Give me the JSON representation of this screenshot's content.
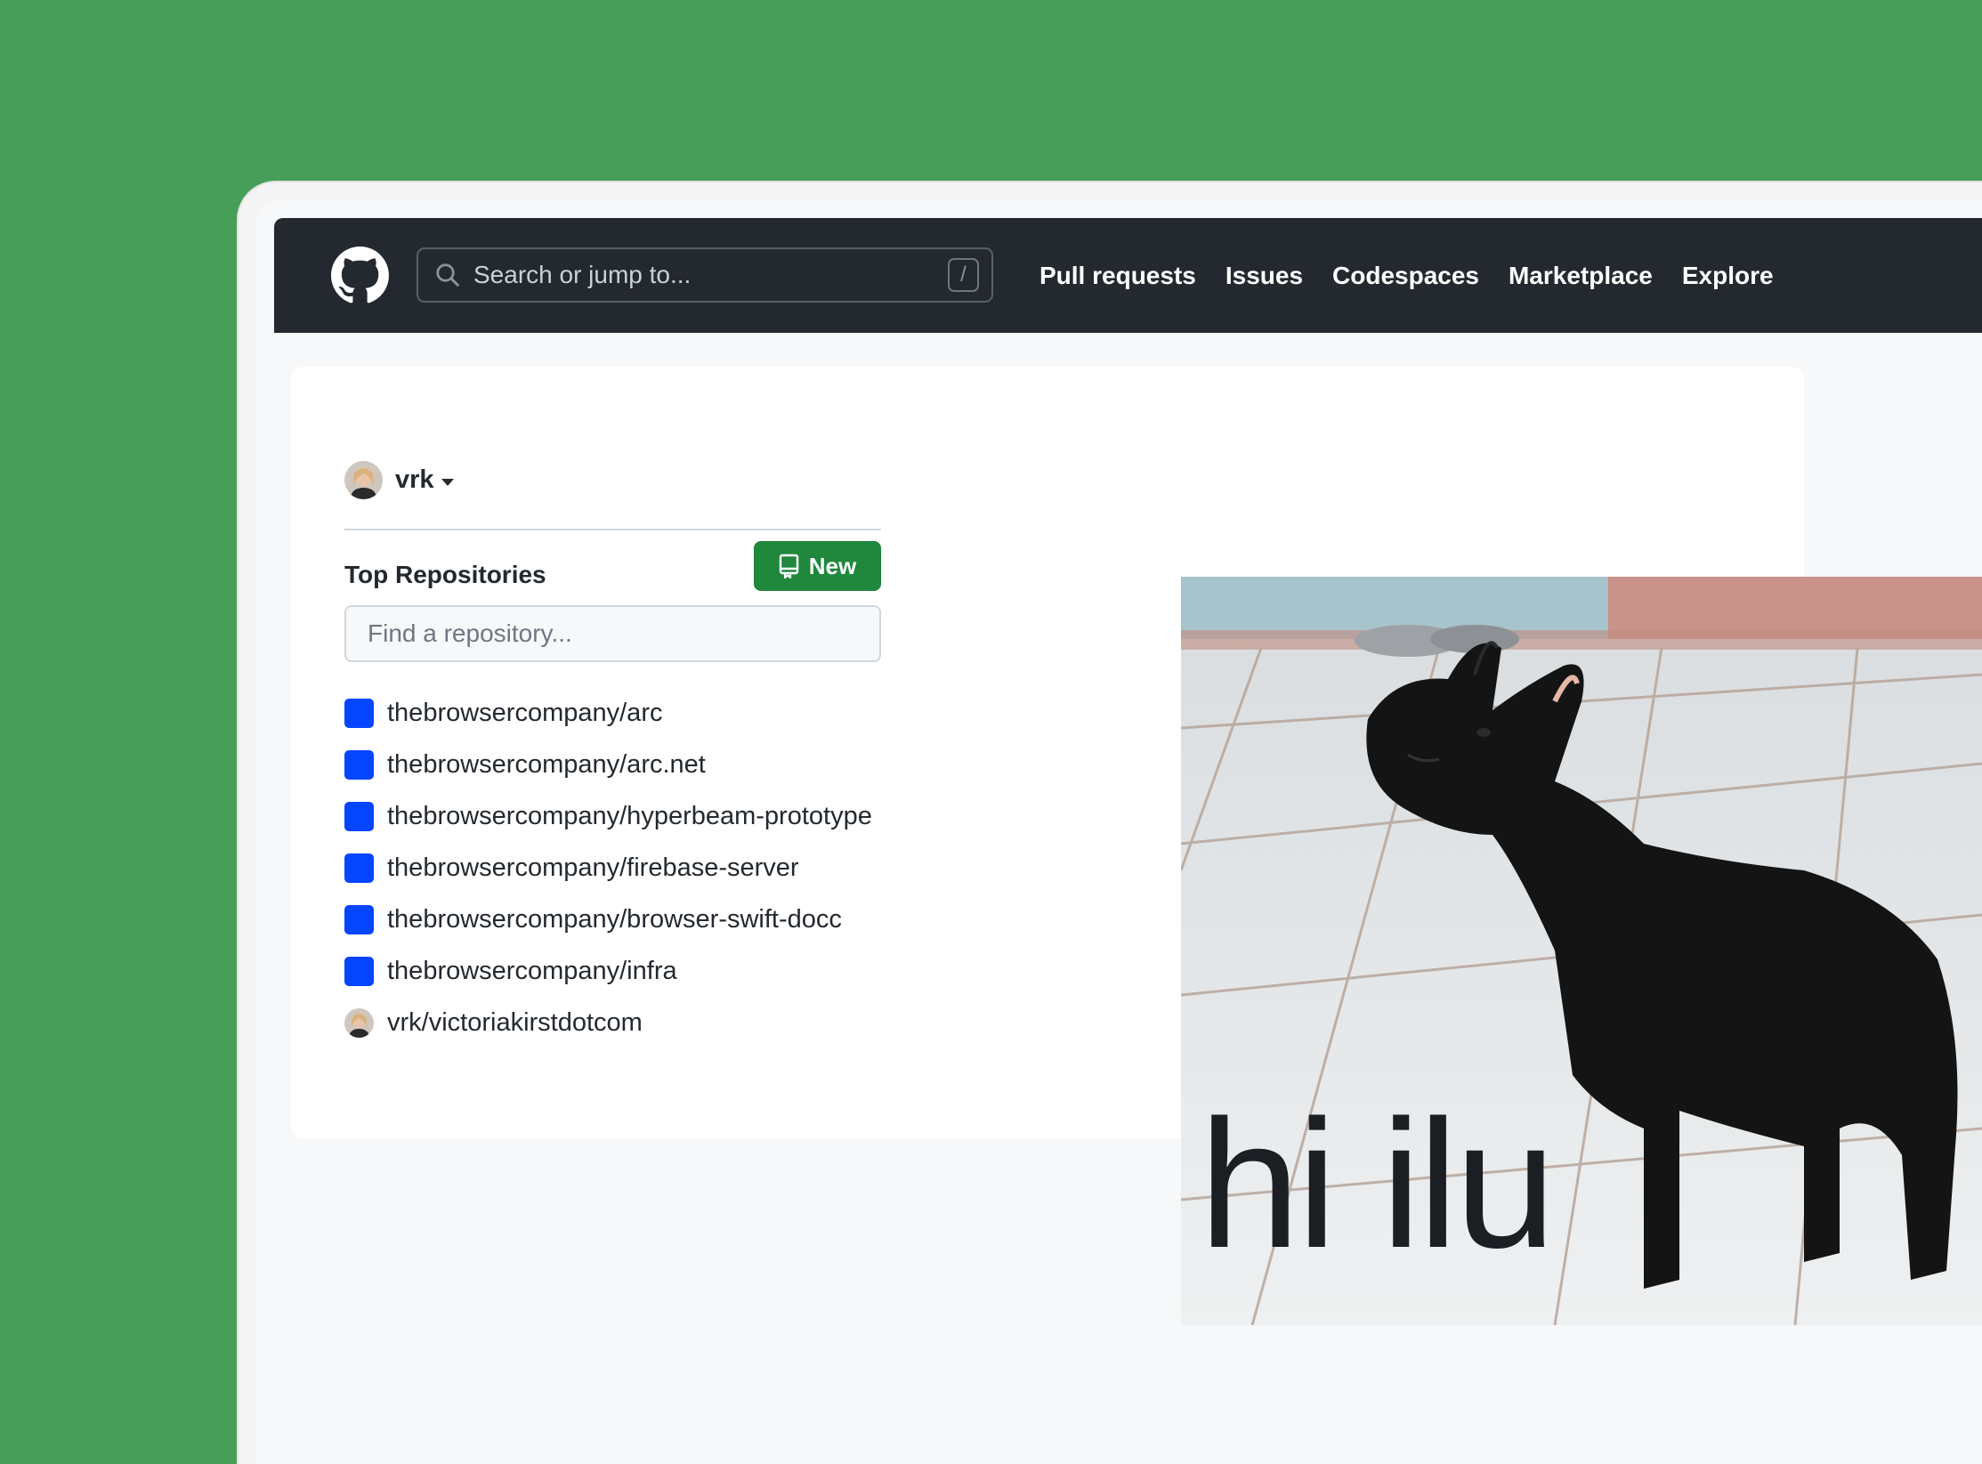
{
  "topbar": {
    "search_placeholder": "Search or jump to...",
    "search_shortcut": "/",
    "nav": [
      "Pull requests",
      "Issues",
      "Codespaces",
      "Marketplace",
      "Explore"
    ]
  },
  "dashboard": {
    "username": "vrk",
    "top_repos_title": "Top Repositories",
    "new_button_label": "New",
    "find_placeholder": "Find a repository...",
    "repos": [
      {
        "name": "thebrowsercompany/arc",
        "icon": "org-square"
      },
      {
        "name": "thebrowsercompany/arc.net",
        "icon": "org-square"
      },
      {
        "name": "thebrowsercompany/hyperbeam-prototype",
        "icon": "org-square"
      },
      {
        "name": "thebrowsercompany/firebase-server",
        "icon": "org-square"
      },
      {
        "name": "thebrowsercompany/browser-swift-docc",
        "icon": "org-square"
      },
      {
        "name": "thebrowsercompany/infra",
        "icon": "org-square"
      },
      {
        "name": "vrk/victoriakirstdotcom",
        "icon": "user-avatar"
      }
    ]
  },
  "photo": {
    "caption": "hi ilu"
  },
  "colors": {
    "background": "#469e58",
    "topbar": "#24292f",
    "new_button": "#1f883d",
    "org_square": "#0645ff"
  }
}
